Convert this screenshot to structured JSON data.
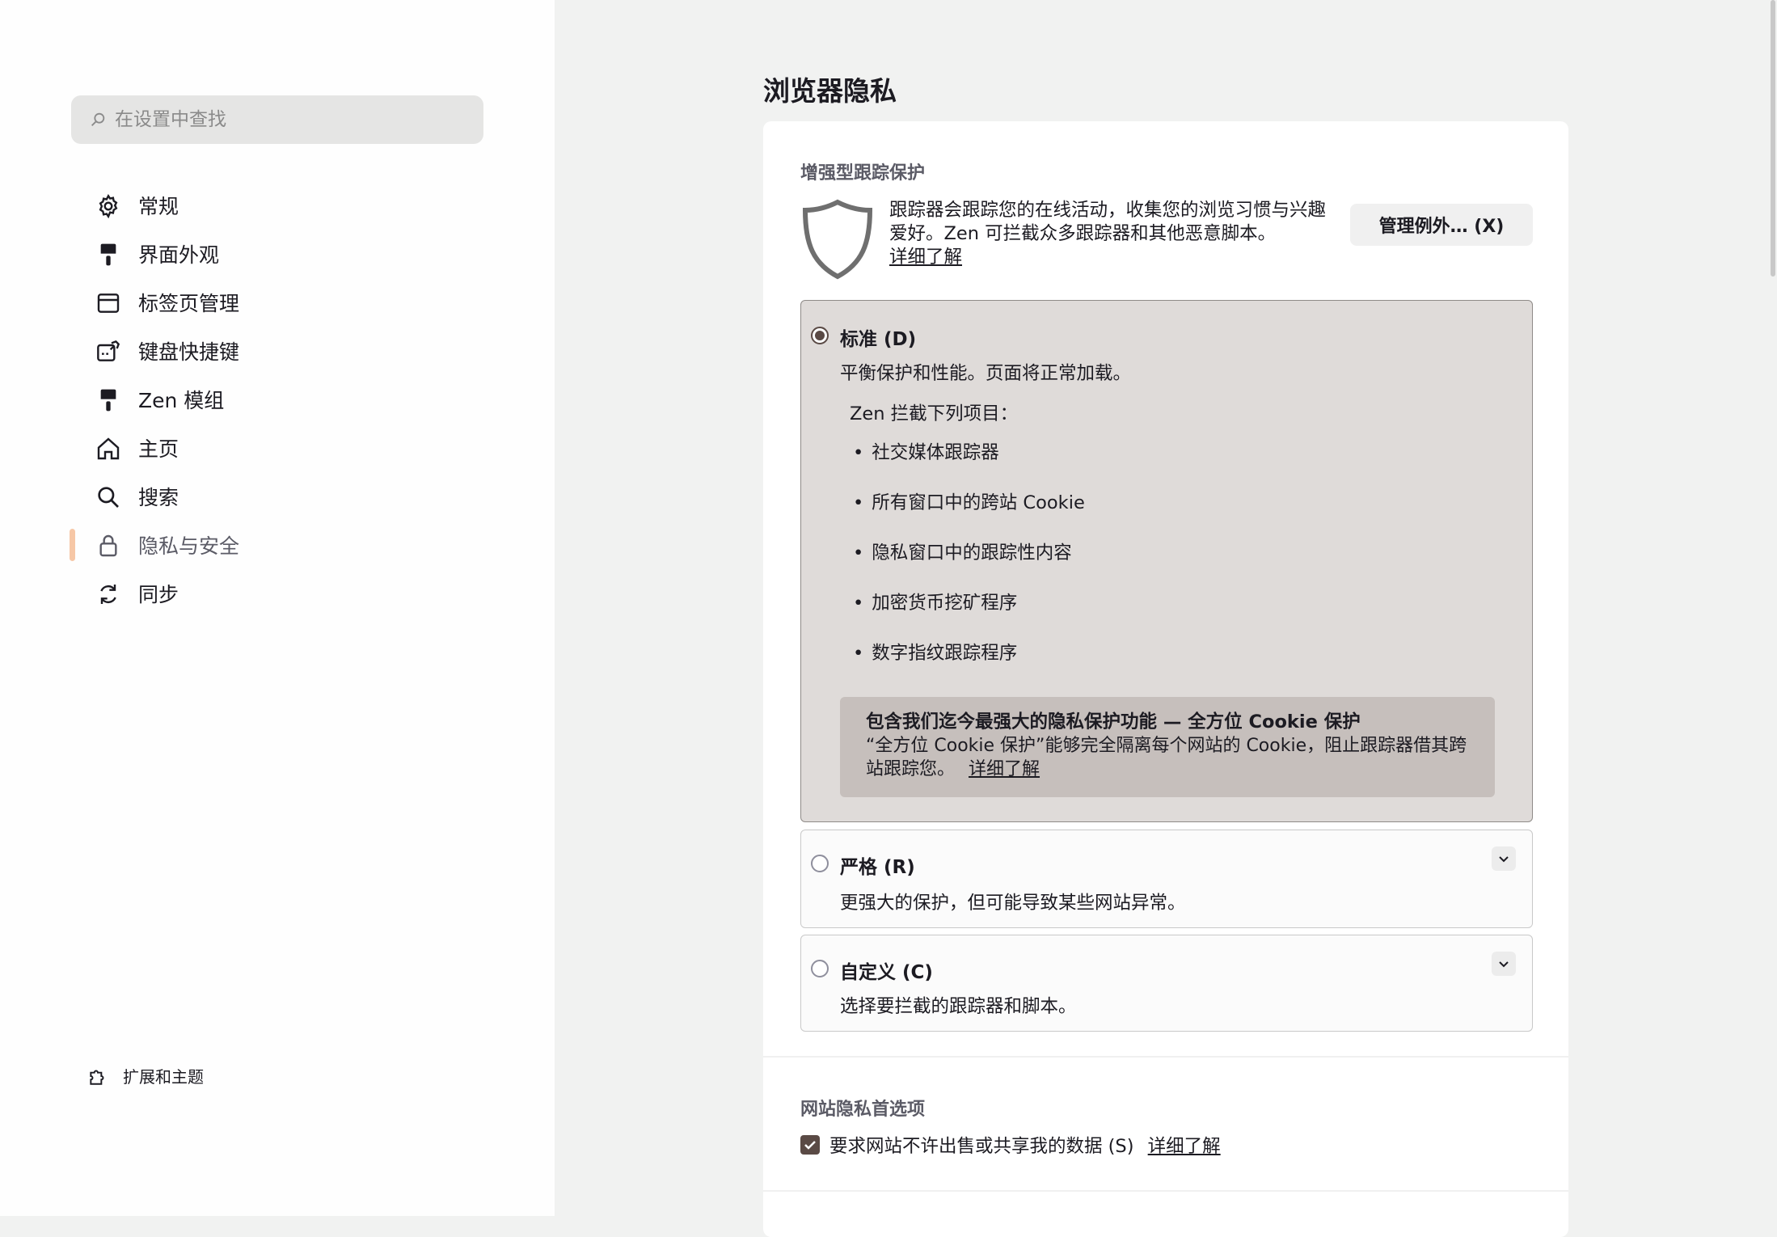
{
  "sidebar": {
    "search_placeholder": "在设置中查找",
    "items": [
      {
        "label": "常规",
        "icon": "gear-icon"
      },
      {
        "label": "界面外观",
        "icon": "paintbrush-icon"
      },
      {
        "label": "标签页管理",
        "icon": "tab-icon"
      },
      {
        "label": "键盘快捷键",
        "icon": "keyboard-icon"
      },
      {
        "label": "Zen 模组",
        "icon": "paintbrush-icon"
      },
      {
        "label": "主页",
        "icon": "home-icon"
      },
      {
        "label": "搜索",
        "icon": "search-icon"
      },
      {
        "label": "隐私与安全",
        "icon": "lock-icon",
        "active": true
      },
      {
        "label": "同步",
        "icon": "sync-icon"
      }
    ],
    "footer_label": "扩展和主题"
  },
  "main": {
    "title": "浏览器隐私",
    "etp": {
      "section_title": "增强型跟踪保护",
      "description": "跟踪器会跟踪您的在线活动，收集您的浏览习惯与兴趣爱好。Zen 可拦截众多跟踪器和其他恶意脚本。",
      "learn_more": "详细了解",
      "manage_button": "管理例外… (X)",
      "options": {
        "standard": {
          "title": "标准 (D)",
          "desc": "平衡保护和性能。页面将正常加载。",
          "blocks_head": "Zen 拦截下列项目：",
          "bullets": [
            "社交媒体跟踪器",
            "所有窗口中的跨站 Cookie",
            "隐私窗口中的跟踪性内容",
            "加密货币挖矿程序",
            "数字指纹跟踪程序"
          ],
          "tcp_title": "包含我们迄今最强大的隐私保护功能 — 全方位 Cookie 保护",
          "tcp_desc": "“全方位 Cookie 保护”能够完全隔离每个网站的 Cookie，阻止跟踪器借其跨站跟踪您。",
          "tcp_link": "详细了解"
        },
        "strict": {
          "title": "严格 (R)",
          "desc": "更强大的保护，但可能导致某些网站异常。"
        },
        "custom": {
          "title": "自定义 (C)",
          "desc": "选择要拦截的跟踪器和脚本。"
        }
      }
    },
    "site_privacy": {
      "section_title": "网站隐私首选项",
      "checkbox_label": "要求网站不许出售或共享我的数据 (S)",
      "learn_more": "详细了解"
    }
  },
  "colors": {
    "accent": "#5a4a45",
    "active_marker": "#f6c7a6"
  }
}
